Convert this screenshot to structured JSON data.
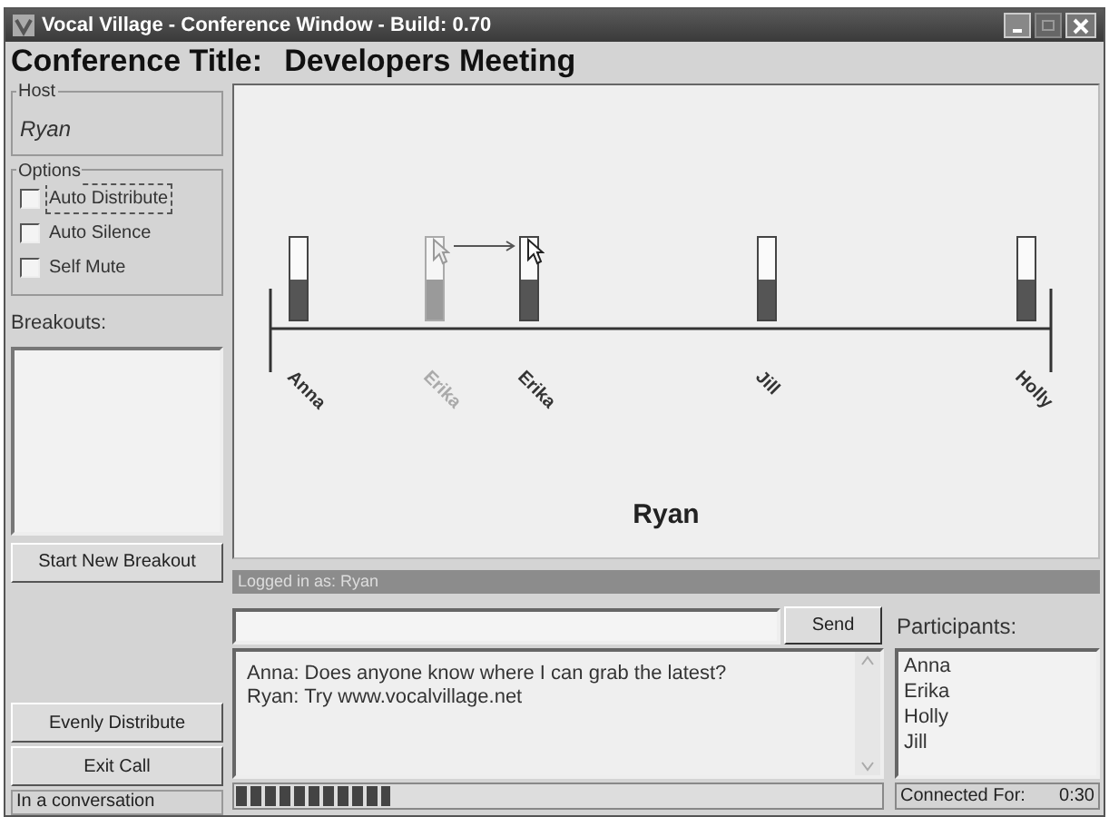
{
  "window": {
    "title": "Vocal Village - Conference Window - Build: 0.70"
  },
  "conference": {
    "label": "Conference Title:",
    "title": "Developers Meeting"
  },
  "host": {
    "label": "Host",
    "name": "Ryan"
  },
  "options": {
    "label": "Options",
    "items": [
      {
        "label": "Auto Distribute",
        "checked": false,
        "focused": true
      },
      {
        "label": "Auto Silence",
        "checked": false,
        "focused": false
      },
      {
        "label": "Self Mute",
        "checked": false,
        "focused": false
      }
    ]
  },
  "breakouts": {
    "label": "Breakouts:",
    "button": "Start New Breakout"
  },
  "stage": {
    "speakers": [
      {
        "name": "Anna",
        "level": 0.5,
        "ghost": false
      },
      {
        "name": "Erika",
        "level": 0.5,
        "ghost": true
      },
      {
        "name": "Erika",
        "level": 0.5,
        "ghost": false
      },
      {
        "name": "Jill",
        "level": 0.5,
        "ghost": false
      },
      {
        "name": "Holly",
        "level": 0.5,
        "ghost": false
      }
    ],
    "listener": "Ryan"
  },
  "logged_in": "Logged in as: Ryan",
  "chat": {
    "send": "Send",
    "messages": [
      "Anna: Does anyone know where I can grab the latest?",
      "Ryan: Try www.vocalvillage.net"
    ]
  },
  "participants": {
    "label": "Participants:",
    "items": [
      "Anna",
      "Erika",
      "Holly",
      "Jill"
    ]
  },
  "buttons": [
    "Evenly Distribute",
    "Exit Call"
  ],
  "status_bar": {
    "status": "In a conversation",
    "level": 0.24,
    "connected_label": "Connected For:",
    "connected_time": "0:30"
  }
}
